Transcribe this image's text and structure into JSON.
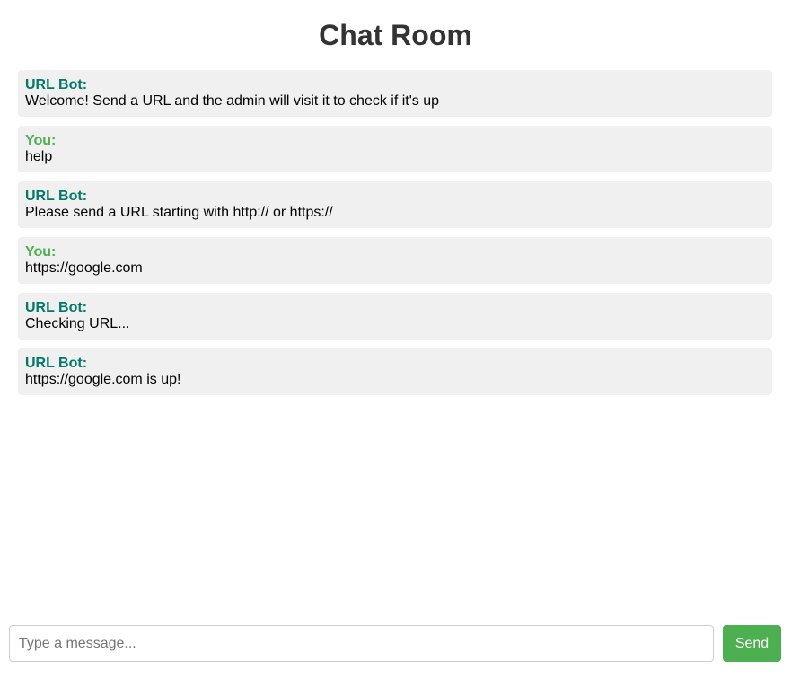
{
  "header": {
    "title": "Chat Room"
  },
  "colors": {
    "bot_sender": "#00796b",
    "user_sender": "#4caf50",
    "message_bg": "#f0f0f0",
    "send_button": "#4caf50"
  },
  "messages": [
    {
      "sender": "URL Bot:",
      "role": "bot",
      "text": "Welcome! Send a URL and the admin will visit it to check if it's up"
    },
    {
      "sender": "You:",
      "role": "user",
      "text": "help"
    },
    {
      "sender": "URL Bot:",
      "role": "bot",
      "text": "Please send a URL starting with http:// or https://"
    },
    {
      "sender": "You:",
      "role": "user",
      "text": "https://google.com"
    },
    {
      "sender": "URL Bot:",
      "role": "bot",
      "text": "Checking URL..."
    },
    {
      "sender": "URL Bot:",
      "role": "bot",
      "text": "https://google.com is up!"
    }
  ],
  "composer": {
    "placeholder": "Type a message...",
    "value": "",
    "send_label": "Send"
  }
}
